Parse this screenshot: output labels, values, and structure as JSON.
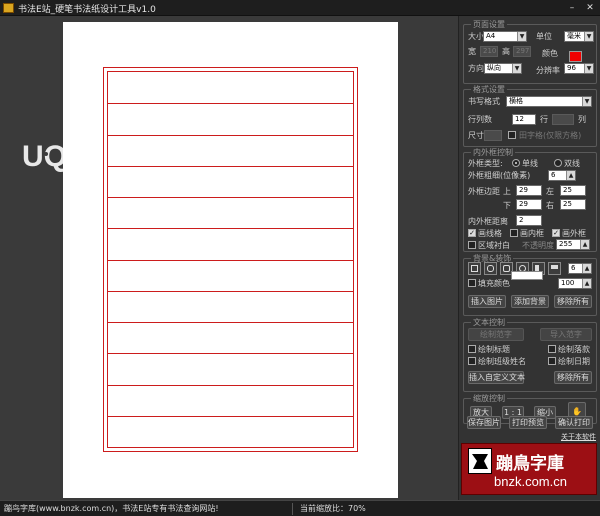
{
  "window": {
    "title": "书法E站_硬笔书法纸设计工具v1.0",
    "minimize": "–",
    "close": "✕"
  },
  "page_setup": {
    "legend": "页面设置",
    "size_label": "大小",
    "size_value": "A4",
    "unit_label": "单位",
    "unit_value": "毫米",
    "width_label": "宽",
    "width_value": "210",
    "height_label": "高",
    "height_value": "297",
    "color_label": "颜色",
    "color_value": "#f10000",
    "orient_label": "方向",
    "orient_value": "纵向",
    "dpi_label": "分辨率",
    "dpi_value": "96"
  },
  "grid": {
    "legend": "格式设置",
    "format_label": "书写格式",
    "format_value": "横格",
    "rows_label": "行列数",
    "rows_value": "12",
    "rows_unit": "行",
    "cols_value": "",
    "cols_unit": "列",
    "size_label": "尺寸",
    "size_value": "",
    "tianzi_label": "田字格(仅限方格)"
  },
  "frame": {
    "legend": "内外框控制",
    "type_label": "外框类型:",
    "single_label": "单线",
    "double_label": "双线",
    "thickness_label": "外框粗细(位像素)",
    "thickness_value": "6",
    "margin_label": "外框边距",
    "top_label": "上",
    "top_value": "29",
    "left_label": "左",
    "left_value": "25",
    "bottom_label": "下",
    "bottom_value": "29",
    "right_label": "右",
    "right_value": "25",
    "gap_label": "内外框距离",
    "gap_value": "2",
    "row_line_label": "画线格",
    "inner_frame_label": "画内框",
    "outer_frame_label": "画外框",
    "fill_white_label": "区域衬白",
    "opacity_label": "不透明度",
    "opacity_value": "255"
  },
  "background": {
    "legend": "背景&装饰",
    "shape_value": "6",
    "fill_label": "填充颜色",
    "fill_color": "#ffffff",
    "fill_value": "100",
    "insert_image": "插入图片",
    "add_bg": "添加背景",
    "remove_all": "移除所有"
  },
  "text": {
    "legend": "文本控制",
    "draw_text": "绘制范字",
    "import_text": "导入范字",
    "draw_title": "绘制标题",
    "draw_author": "绘制落款",
    "draw_class": "绘制班级姓名",
    "draw_date": "绘制日期",
    "insert_custom": "插入自定义文本",
    "remove_all": "移除所有"
  },
  "zoom": {
    "legend": "缩放控制",
    "zoom_in": "放大",
    "actual": "1 : 1",
    "zoom_out": "缩小"
  },
  "actions": {
    "save_image": "保存图片",
    "print_preview": "打印预览",
    "print": "确认打印",
    "about": "关于本软件"
  },
  "logo": {
    "cn": "蹦鳥字庫",
    "en": "bnzk.com.cn"
  },
  "status": {
    "left": "蹦鸟字库(www.bnzk.com.cn)，书法E站专有书法查询网站!",
    "right": "当前缩放比：70%"
  },
  "paper": {
    "row_count": 12,
    "line_color": "#cc1c1c"
  }
}
